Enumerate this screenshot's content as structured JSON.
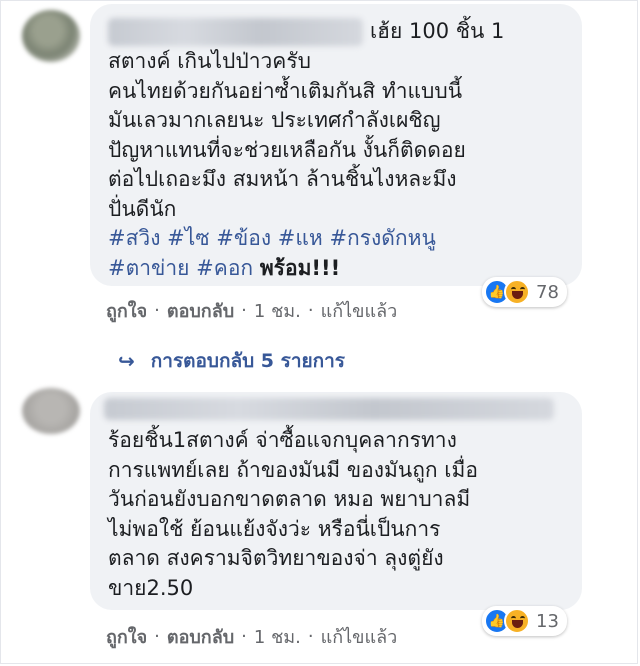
{
  "comments": [
    {
      "first_line_tail": "เฮ้ย 100 ชิ้น 1",
      "lines": [
        "สตางค์ เกินไปป่าวครับ",
        "คนไทยด้วยกันอย่าซ้ำเติมกันสิ ทำแบบนี้",
        "มันเลวมากเลยนะ ประเทศกำลังเผชิญ",
        "ปัญหาแทนที่จะช่วยเหลือกัน งั้นก็ติดดอย",
        "ต่อไปเถอะมึง สมหน้า ล้านชิ้นไงหละมึง",
        "ปั่นดีนัก"
      ],
      "tags_line1": [
        "#สวิง",
        "#ไซ",
        "#ข้อง",
        "#แห",
        "#กรงดักหนู"
      ],
      "tags_line2": [
        "#ตาข่าย",
        "#คอก"
      ],
      "tags_tail": "พร้อม!!!",
      "reaction_count": "78",
      "actions": {
        "like": "ถูกใจ",
        "reply": "ตอบกลับ",
        "time": "1 ชม.",
        "edited": "แก้ไขแล้ว",
        "sep": "·"
      }
    },
    {
      "lines": [
        "ร้อยชิ้น1สตางค์ จ่าซื้อแจกบุคลากรทาง",
        "การแพทย์เลย ถ้าของมันมี ของมันถูก เมื่อ",
        "วันก่อนยังบอกขาดตลาด หมอ พยาบาลมี",
        "ไม่พอใช้ ย้อนแย้งจังว่ะ หรือนี่เป็นการ",
        "ตลาด สงครามจิตวิทยาของจ่า ลุงตู่ยัง",
        "ขาย2.50"
      ],
      "reaction_count": "13",
      "actions": {
        "like": "ถูกใจ",
        "reply": "ตอบกลับ",
        "time": "1 ชม.",
        "edited": "แก้ไขแล้ว",
        "sep": "·"
      }
    }
  ],
  "replies_link": {
    "icon": "reply-arrow-icon",
    "label": "การตอบกลับ 5 รายการ"
  },
  "colors": {
    "bubble": "#f0f2f5",
    "link": "#385898",
    "muted": "#65676b",
    "like": "#1877f2",
    "haha": "#f7b125"
  }
}
